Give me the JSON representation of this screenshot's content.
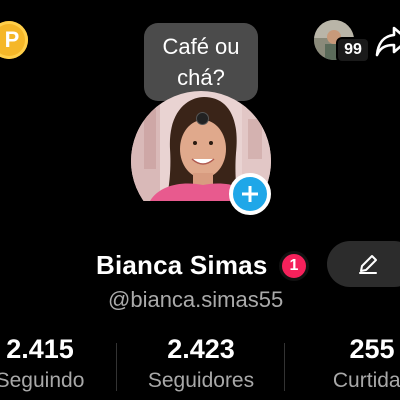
{
  "coins": {
    "symbol": "P"
  },
  "top_right": {
    "count": "99"
  },
  "bubble": {
    "line1": "Café ou",
    "line2": "chá?"
  },
  "profile": {
    "name": "Bianca Simas",
    "notification_count": "1",
    "handle": "@bianca.simas55"
  },
  "stats": [
    {
      "value": "2.415",
      "label": "Seguindo"
    },
    {
      "value": "2.423",
      "label": "Seguidores"
    },
    {
      "value": "255",
      "label": "Curtidas"
    }
  ],
  "colors": {
    "background": "#000000",
    "accent_blue": "#1fa7e8",
    "notification_pink": "#f5215b",
    "coin_gold": "#f5b728"
  }
}
